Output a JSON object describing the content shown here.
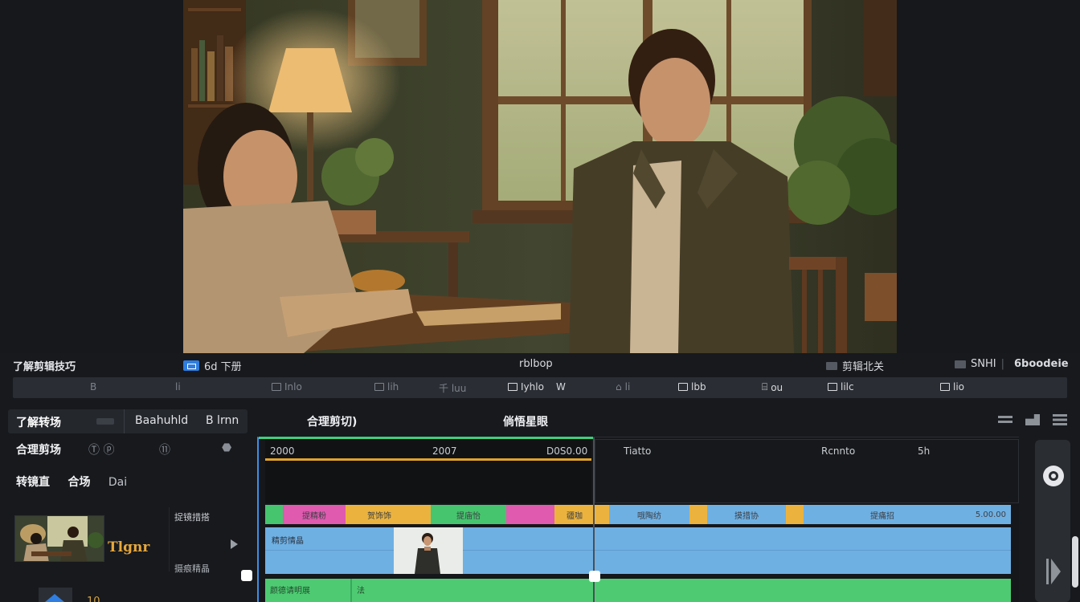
{
  "viewer": {
    "info": {
      "clip_title": "了解剪辑技巧",
      "left_label": "6d 下册",
      "center_label": "rblbop",
      "right_label_1": "剪辑北关",
      "right_label_2": "SNHI",
      "right_label_3": "6boodeie"
    }
  },
  "toolbar": {
    "items": [
      "B",
      "li",
      "Inlo",
      "lih",
      "千 luu",
      "Iyhlo",
      "lilo",
      "W",
      "li",
      "lbb",
      "ou",
      "lilc",
      "lio"
    ]
  },
  "left_panel": {
    "tabs": [
      "了解转场",
      "Baahuhld",
      "B lrnn"
    ],
    "row_a": {
      "label": "合理剪场",
      "icon_1": "Ⓣ ⓟ",
      "icon_2": "⑪"
    },
    "row_b": [
      "转镜直",
      "合场",
      "Dai"
    ],
    "media": {
      "title": "Tlgnr",
      "side_top": "捉镜措搭",
      "side_bottom": "摄痕精晶"
    },
    "bottom_text": "10"
  },
  "timeline": {
    "head_label_1": "合理剪切)",
    "head_label_2": "倘悟星眼",
    "ruler_ticks": [
      "2000",
      "2007",
      "D0S0.00",
      "Tiatto",
      "Rcnnto",
      "5h"
    ],
    "track_1": [
      {
        "label": "",
        "color": "#47c46e"
      },
      {
        "label": "提精粉",
        "color": "#e05aaf"
      },
      {
        "label": "贺饰饰",
        "color": "#ebb33e"
      },
      {
        "label": "",
        "color": "#ebb33e"
      },
      {
        "label": "提庙怡",
        "color": "#47c46e"
      },
      {
        "label": "",
        "color": "#e05aaf"
      },
      {
        "label": "疆咖",
        "color": "#ebb33e"
      },
      {
        "label": "",
        "color": "#ebb33e"
      },
      {
        "label": "哦陶纺",
        "color": "#6fb0e3"
      },
      {
        "label": "",
        "color": "#ebb33e"
      },
      {
        "label": "摸措协",
        "color": "#6fb0e3"
      },
      {
        "label": "",
        "color": "#ebb33e"
      },
      {
        "label": "提痛招",
        "color": "#6fb0e3"
      },
      {
        "label": "5.00.00",
        "color": "#6fb0e3"
      }
    ],
    "track_2_label": "精剪情晶",
    "track_3_labels": [
      "颜德请明展",
      "法"
    ]
  }
}
